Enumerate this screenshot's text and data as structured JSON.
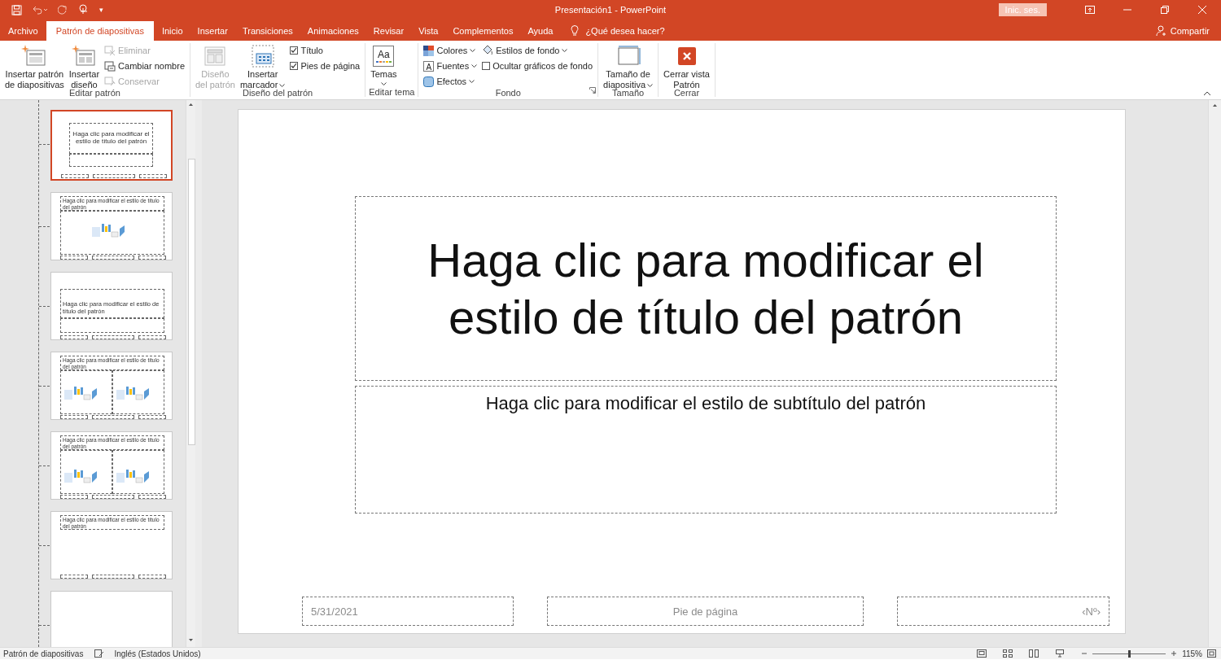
{
  "title_bar": {
    "title": "Presentación1  -  PowerPoint",
    "sign_in": "Inic. ses.",
    "qat_more": "▾"
  },
  "tabs": [
    {
      "label": "Archivo",
      "selected": false
    },
    {
      "label": "Patrón de diapositivas",
      "selected": true
    },
    {
      "label": "Inicio",
      "selected": false
    },
    {
      "label": "Insertar",
      "selected": false
    },
    {
      "label": "Transiciones",
      "selected": false
    },
    {
      "label": "Animaciones",
      "selected": false
    },
    {
      "label": "Revisar",
      "selected": false
    },
    {
      "label": "Vista",
      "selected": false
    },
    {
      "label": "Complementos",
      "selected": false
    },
    {
      "label": "Ayuda",
      "selected": false
    }
  ],
  "tell_me": "¿Qué desea hacer?",
  "share": "Compartir",
  "ribbon_groups": [
    {
      "label": "Editar patrón",
      "items": [
        {
          "kind": "large",
          "lines": [
            "Insertar patrón",
            "de diapositivas"
          ],
          "disabled": false
        },
        {
          "kind": "large",
          "lines": [
            "Insertar",
            "diseño"
          ],
          "disabled": false
        },
        {
          "kind": "stack",
          "children": [
            {
              "kind": "small",
              "label": "Eliminar",
              "disabled": true
            },
            {
              "kind": "small",
              "label": "Cambiar nombre",
              "disabled": false
            },
            {
              "kind": "small",
              "label": "Conservar",
              "disabled": true
            }
          ]
        }
      ]
    },
    {
      "label": "Diseño del patrón",
      "items": [
        {
          "kind": "large",
          "lines": [
            "Diseño",
            "del patrón"
          ],
          "disabled": true
        },
        {
          "kind": "large",
          "lines": [
            "Insertar",
            "marcador"
          ],
          "disabled": false,
          "dropdown": true
        },
        {
          "kind": "stack",
          "children": [
            {
              "kind": "checkbox",
              "label": "Título",
              "checked": true
            },
            {
              "kind": "checkbox",
              "label": "Pies de página",
              "checked": true
            }
          ]
        }
      ]
    },
    {
      "label": "Editar tema",
      "items": [
        {
          "kind": "large",
          "lines": [
            "Temas"
          ],
          "icon_text": "Aa",
          "disabled": false,
          "dropdown": true
        }
      ]
    },
    {
      "label": "Fondo",
      "launcher": true,
      "items": [
        {
          "kind": "stack",
          "children": [
            {
              "kind": "small",
              "label": "Colores",
              "disabled": false,
              "dropdown": true
            },
            {
              "kind": "small",
              "label": "Fuentes",
              "icon_text": "A",
              "disabled": false,
              "dropdown": true
            },
            {
              "kind": "small",
              "label": "Efectos",
              "disabled": false,
              "dropdown": true
            }
          ]
        },
        {
          "kind": "stack",
          "children": [
            {
              "kind": "small",
              "label": "Estilos de fondo",
              "disabled": false,
              "dropdown": true
            },
            {
              "kind": "checkbox",
              "label": "Ocultar gráficos de fondo",
              "checked": false
            }
          ]
        }
      ]
    },
    {
      "label": "Tamaño",
      "items": [
        {
          "kind": "large",
          "lines": [
            "Tamaño de",
            "diapositiva"
          ],
          "disabled": false,
          "dropdown": true
        }
      ]
    },
    {
      "label": "Cerrar",
      "items": [
        {
          "kind": "large",
          "lines": [
            "Cerrar vista",
            "Patrón"
          ],
          "disabled": false
        }
      ]
    }
  ],
  "thumbnails": [
    {
      "kind": "title",
      "title": "Haga clic para modificar el estilo de título del patrón",
      "selected": true
    },
    {
      "kind": "content",
      "title": "Haga clic para modificar el estilo de título del patrón",
      "selected": false
    },
    {
      "kind": "section",
      "title": "Haga clic para modificar el estilo de título del patrón",
      "selected": false
    },
    {
      "kind": "two_content",
      "title": "Haga clic para modificar el estilo de título del patrón",
      "selected": false
    },
    {
      "kind": "comparison",
      "title": "Haga clic para modificar el estilo de título del patrón",
      "selected": false
    },
    {
      "kind": "title_only",
      "title": "Haga clic para modificar el estilo de título del patrón",
      "selected": false
    },
    {
      "kind": "blank",
      "selected": false
    }
  ],
  "slide": {
    "title": "Haga clic para modificar el estilo de título del patrón",
    "subtitle": "Haga clic para modificar el estilo de subtítulo del patrón",
    "footer_date": "5/31/2021",
    "footer_text": "Pie de página",
    "footer_number": "‹Nº›"
  },
  "status_bar": {
    "view": "Patrón de diapositivas",
    "language": "Inglés (Estados Unidos)",
    "zoom": {
      "level": 0.5,
      "reading": "115%"
    }
  }
}
